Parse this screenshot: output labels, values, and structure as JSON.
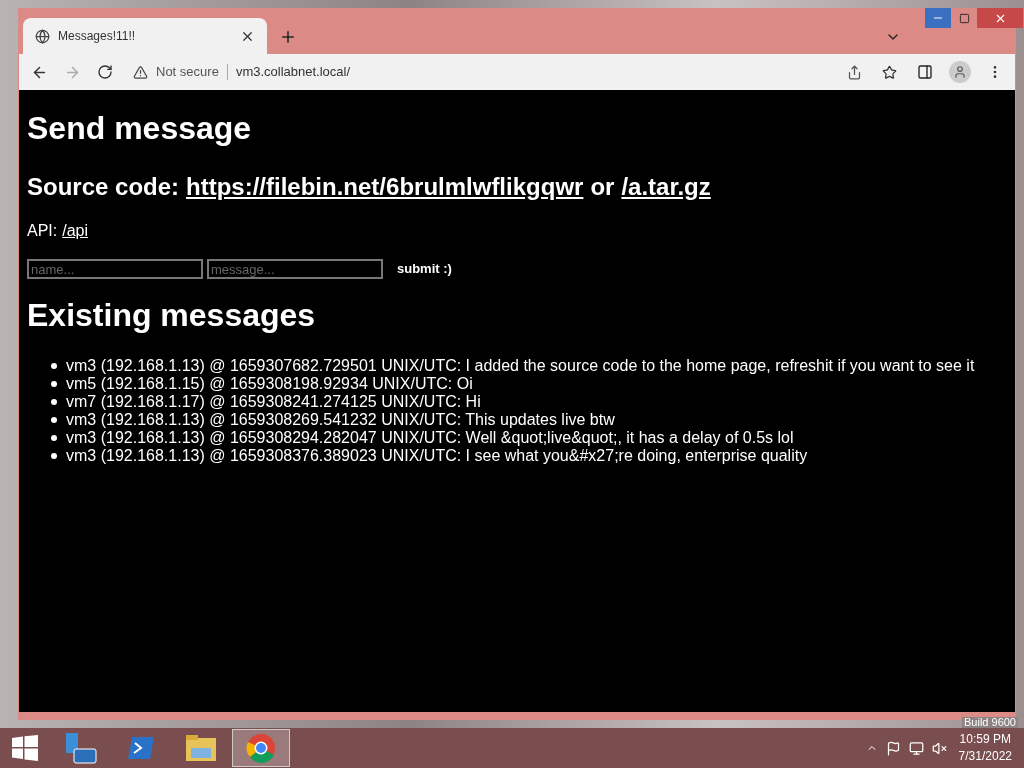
{
  "desktop": {
    "build_text": "Build 9600"
  },
  "browser": {
    "tabs": [
      {
        "title": "Messages!11!!",
        "selected": true
      }
    ],
    "address_bar": {
      "security": "Not secure",
      "url": "vm3.collabnet.local/"
    }
  },
  "page": {
    "heading": "Send message",
    "source": {
      "label": "Source code:",
      "link": "https://filebin.net/6brulmlwflikgqwr",
      "separator": "or",
      "archive_link": "/a.tar.gz"
    },
    "api": {
      "label": "API:",
      "link": "/api"
    },
    "form": {
      "name_placeholder": "name...",
      "message_placeholder": "message...",
      "submit": "submit :)"
    },
    "messages_heading": "Existing messages",
    "messages": [
      {
        "text": "vm3 (192.168.1.13) @ 1659307682.729501 UNIX/UTC: I added the source code to the home page, refreshit if you want to see it"
      },
      {
        "text": "vm5 (192.168.1.15) @ 1659308198.92934 UNIX/UTC: Oi"
      },
      {
        "text": "vm7 (192.168.1.17) @ 1659308241.274125 UNIX/UTC: Hi"
      },
      {
        "text": "vm3 (192.168.1.13) @ 1659308269.541232 UNIX/UTC: This updates live btw"
      },
      {
        "text": "vm3 (192.168.1.13) @ 1659308294.282047 UNIX/UTC: Well &quot;live&quot;, it has a delay of 0.5s lol"
      },
      {
        "text": "vm3 (192.168.1.13) @ 1659308376.389023 UNIX/UTC: I see what you&#x27;re doing, enterprise quality"
      }
    ]
  },
  "taskbar": {
    "apps": [
      {
        "kind": "server",
        "selected": false
      },
      {
        "kind": "shell",
        "selected": false
      },
      {
        "kind": "folder",
        "selected": false
      },
      {
        "kind": "browser",
        "selected": true
      }
    ],
    "clock": {
      "time": "10:59 PM",
      "date": "7/31/2022"
    }
  }
}
